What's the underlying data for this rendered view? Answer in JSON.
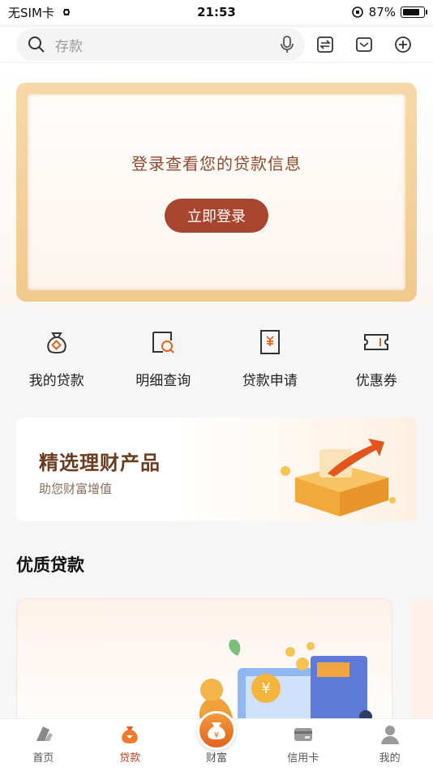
{
  "status_bar": {
    "carrier": "无SIM卡",
    "time": "21:53",
    "battery": "87%",
    "battery_level": 0.87
  },
  "search": {
    "placeholder": "存款"
  },
  "top_icons": [
    "transfer-icon",
    "message-icon",
    "add-icon"
  ],
  "login_card": {
    "title": "登录查看您的贷款信息",
    "button": "立即登录"
  },
  "quick_actions": [
    {
      "label": "我的贷款",
      "icon": "money-bag-icon"
    },
    {
      "label": "明细查询",
      "icon": "detail-search-icon"
    },
    {
      "label": "贷款申请",
      "icon": "loan-apply-icon"
    },
    {
      "label": "优惠券",
      "icon": "coupon-icon"
    }
  ],
  "promo": {
    "title": "精选理财产品",
    "subtitle": "助您财富增值"
  },
  "section": {
    "title": "优质贷款"
  },
  "colors": {
    "accent": "#c7411f",
    "button": "#a8452f",
    "card_border": "#f2c98c"
  },
  "tabbar": [
    {
      "label": "首页",
      "icon": "home-icon",
      "active": false
    },
    {
      "label": "贷款",
      "icon": "loan-icon",
      "active": true
    },
    {
      "label": "财富",
      "icon": "wealth-icon",
      "active": false
    },
    {
      "label": "信用卡",
      "icon": "credit-card-icon",
      "active": false
    },
    {
      "label": "我的",
      "icon": "profile-icon",
      "active": false
    }
  ]
}
